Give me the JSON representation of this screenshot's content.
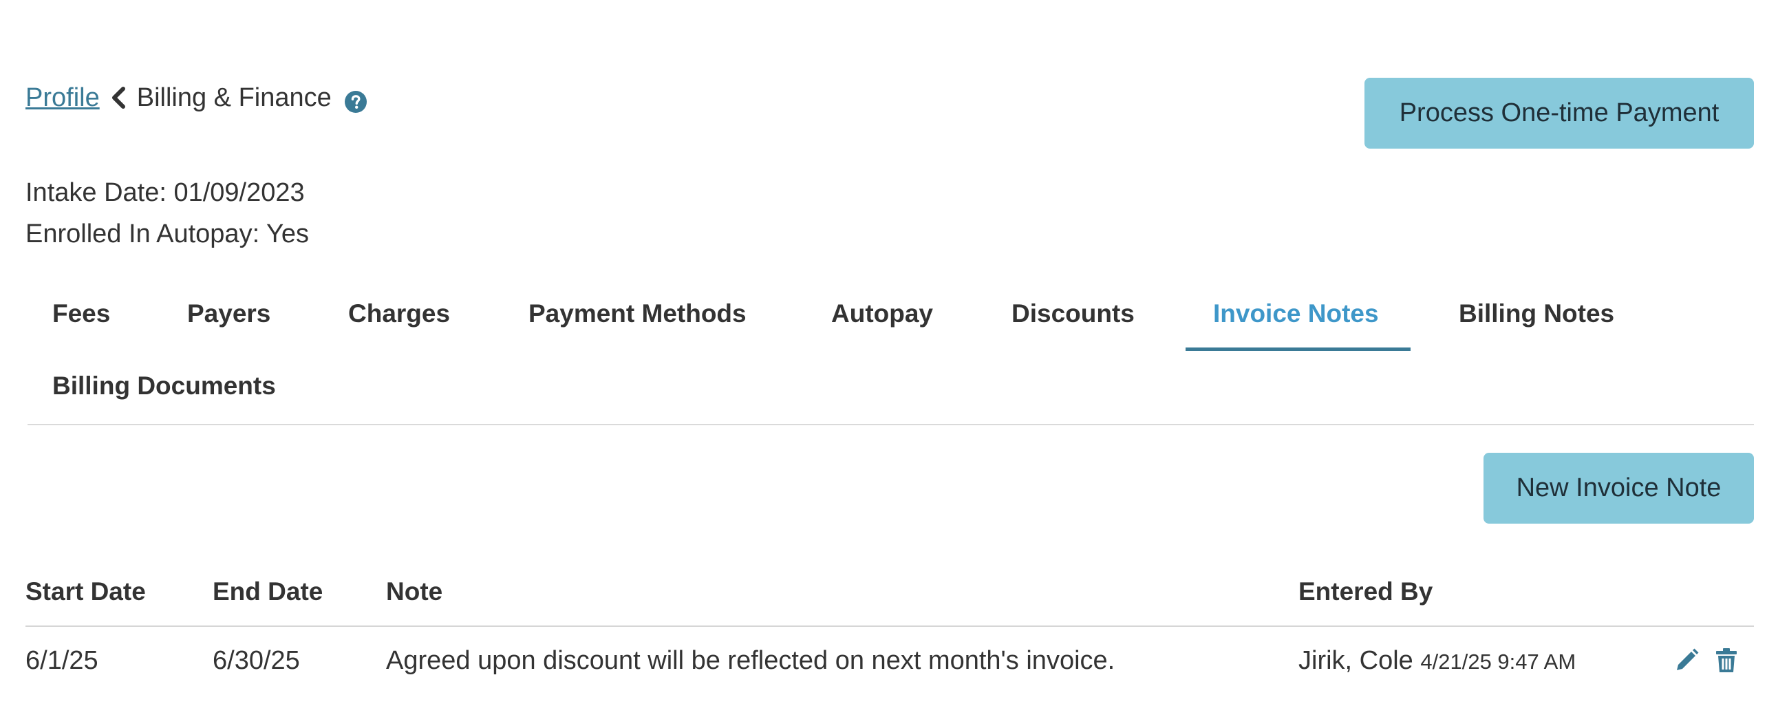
{
  "breadcrumb": {
    "parent": "Profile",
    "current": "Billing & Finance"
  },
  "actions": {
    "process_payment": "Process One-time Payment",
    "new_invoice_note": "New Invoice Note"
  },
  "info": {
    "intake_date": "Intake Date: 01/09/2023",
    "autopay": "Enrolled In Autopay: Yes"
  },
  "tabs": [
    {
      "label": "Fees"
    },
    {
      "label": "Payers"
    },
    {
      "label": "Charges"
    },
    {
      "label": "Payment Methods"
    },
    {
      "label": "Autopay"
    },
    {
      "label": "Discounts"
    },
    {
      "label": "Invoice Notes",
      "active": true
    },
    {
      "label": "Billing Notes"
    },
    {
      "label": "Billing Documents"
    }
  ],
  "table": {
    "columns": [
      "Start Date",
      "End Date",
      "Note",
      "Entered By"
    ],
    "rows": [
      {
        "start": "6/1/25",
        "end": "6/30/25",
        "note": "Agreed upon discount will be reflected on next month's invoice.",
        "entered_by": "Jirik, Cole",
        "entered_at": "4/21/25 9:47 AM"
      }
    ]
  },
  "icons": {
    "help": "question-circle-icon",
    "chevron": "chevron-left-icon",
    "edit": "pencil-icon",
    "delete": "trash-icon"
  },
  "colors": {
    "link": "#3a7a96",
    "accent_tab": "#3e97c9",
    "button_bg": "#87c9db"
  }
}
